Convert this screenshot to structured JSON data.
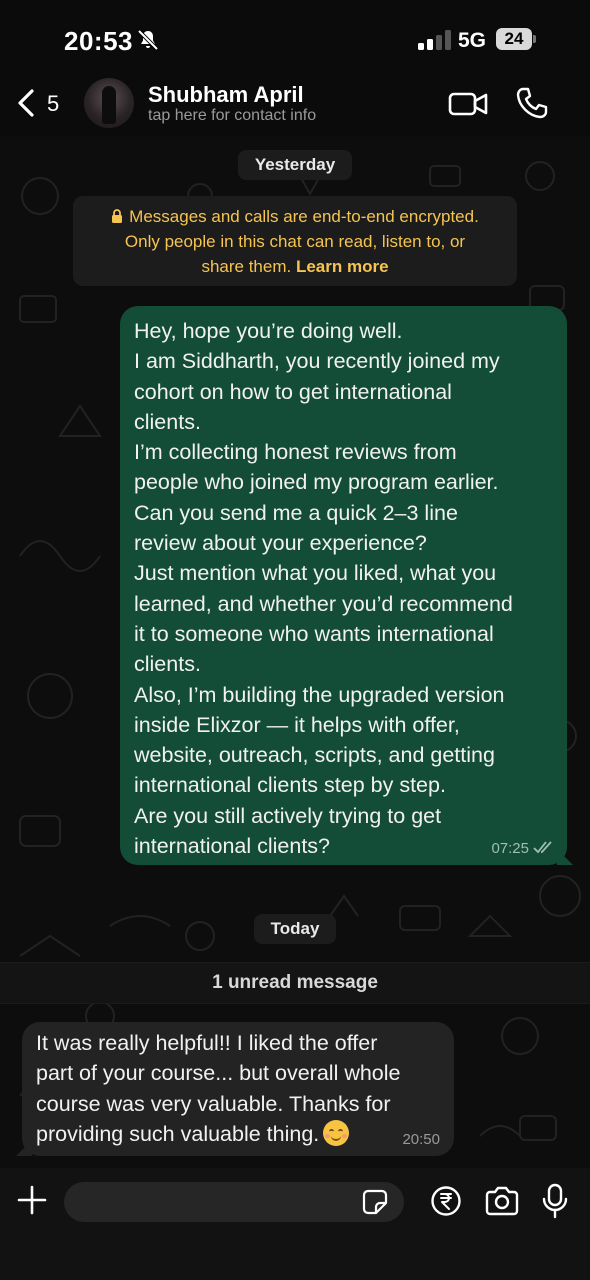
{
  "status_bar": {
    "time": "20:53",
    "network": "5G",
    "battery": "24"
  },
  "header": {
    "back_count": "5",
    "contact_name": "Shubham April",
    "contact_subtitle": "tap here for contact info"
  },
  "chat": {
    "date_yesterday": "Yesterday",
    "encryption_notice": {
      "line1": "Messages and calls are end-to-end encrypted.",
      "line2": "Only people in this chat can read, listen to, or",
      "line3_prefix": "share them. ",
      "learn_more": "Learn more"
    },
    "outgoing": {
      "lines": [
        "Hey, hope you’re doing well.",
        "I am Siddharth, you recently joined my",
        "cohort on how to get international",
        "clients.",
        "I’m collecting honest reviews from",
        "people who joined my program earlier.",
        "Can you send me a quick 2–3 line",
        "review about your experience?",
        "Just mention what you liked, what you",
        "learned, and whether you’d recommend",
        "it to someone who wants international",
        "clients.",
        "Also, I’m building the upgraded version",
        "inside Elixzor — it helps with offer,",
        "website, outreach, scripts, and getting",
        "international clients step by step.",
        "Are you still actively trying to get",
        "international clients?"
      ],
      "time": "07:25",
      "status": "read"
    },
    "date_today": "Today",
    "unread_label": "1 unread message",
    "incoming": {
      "lines": [
        "It was really helpful!! I liked the offer",
        "part of your course... but overall whole",
        "course was very valuable. Thanks for",
        "providing such valuable thing."
      ],
      "emoji": "smiling-face-emoji",
      "time": "20:50"
    }
  },
  "input": {
    "placeholder": "",
    "value": ""
  },
  "colors": {
    "outgoing_bubble": "#134d37",
    "incoming_bubble": "#232323",
    "notice_text": "#f5c451",
    "background": "#0b0b0b"
  }
}
